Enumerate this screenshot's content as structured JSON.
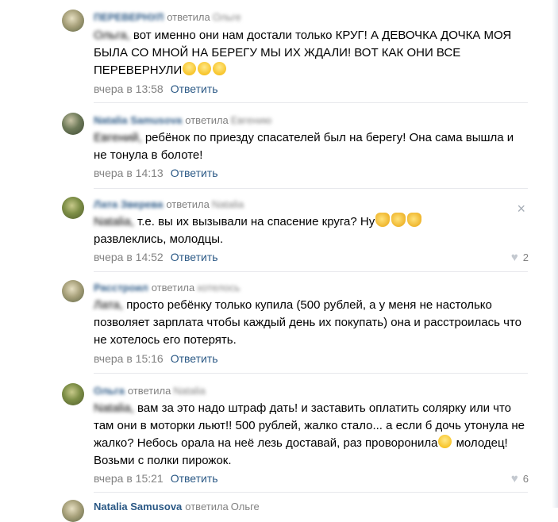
{
  "comments": [
    {
      "author": "ПЕРЕВЕРНУЛ",
      "reply_label": "ответила",
      "reply_to": "Ольге",
      "addressee": "Ольга,",
      "text": "вот именно они нам достали только КРУГ! А ДЕВОЧКА ДОЧКА МОЯ БЫЛА СО МНОЙ НА БЕРЕГУ МЫ ИХ ЖДАЛИ! ВОТ КАК ОНИ ВСЕ ПЕРЕВЕРНУЛИ",
      "emoji": [
        "rofl-emoji",
        "rofl-emoji",
        "rofl-emoji"
      ],
      "time": "вчера в 13:58",
      "reply_button": "Ответить",
      "likes": ""
    },
    {
      "author": "Natalia Samusova",
      "reply_label": "ответила",
      "reply_to": "Евгению",
      "addressee": "Евгений,",
      "text": "ребёнок по приезду спасателей был на берегу! Она сама вышла и не тонула в болоте!",
      "emoji": [],
      "time": "вчера в 14:13",
      "reply_button": "Ответить",
      "likes": ""
    },
    {
      "author": "Лата Зверева",
      "reply_label": "ответила",
      "reply_to": "Natalia",
      "addressee": "Natalia,",
      "text": "т.е. вы их вызывали на спасение круга? Ну",
      "text_after": "развлеклись, молодцы.",
      "emoji": [
        "clap-emoji",
        "clap-emoji",
        "clap-emoji"
      ],
      "time": "вчера в 14:52",
      "reply_button": "Ответить",
      "likes": "2"
    },
    {
      "author": "Расстроил",
      "reply_label": "ответила",
      "reply_to": "хотелось",
      "addressee": "Лата,",
      "text": "просто ребёнку только купила (500 рублей, а у меня не настолько позволяет зарплата чтобы каждый день их покупать) она и расстроилась что не хотелось его потерять.",
      "emoji": [],
      "time": "вчера в 15:16",
      "reply_button": "Ответить",
      "likes": ""
    },
    {
      "author": "Ольга",
      "reply_label": "ответила",
      "reply_to": "Natalia",
      "addressee": "Natalia,",
      "text": "вам за это надо штраф дать! и заставить оплатить солярку или что там они в моторки льют!! 500 рублей, жалко стало... а если б дочь утонула не жалко? Небось орала на неё лезь доставай, раз проворонила",
      "text_after": "молодец! Возьми с полки пирожок.",
      "emoji": [
        "grimace-emoji"
      ],
      "time": "вчера в 15:21",
      "reply_button": "Ответить",
      "likes": "6"
    },
    {
      "author": "Natalia Samusova",
      "reply_label": "ответила",
      "reply_to": "Ольге",
      "addressee": "",
      "text": "",
      "emoji": [],
      "time": "",
      "reply_button": "",
      "likes": ""
    }
  ],
  "close_icon": "×",
  "heart_icon": "♥"
}
